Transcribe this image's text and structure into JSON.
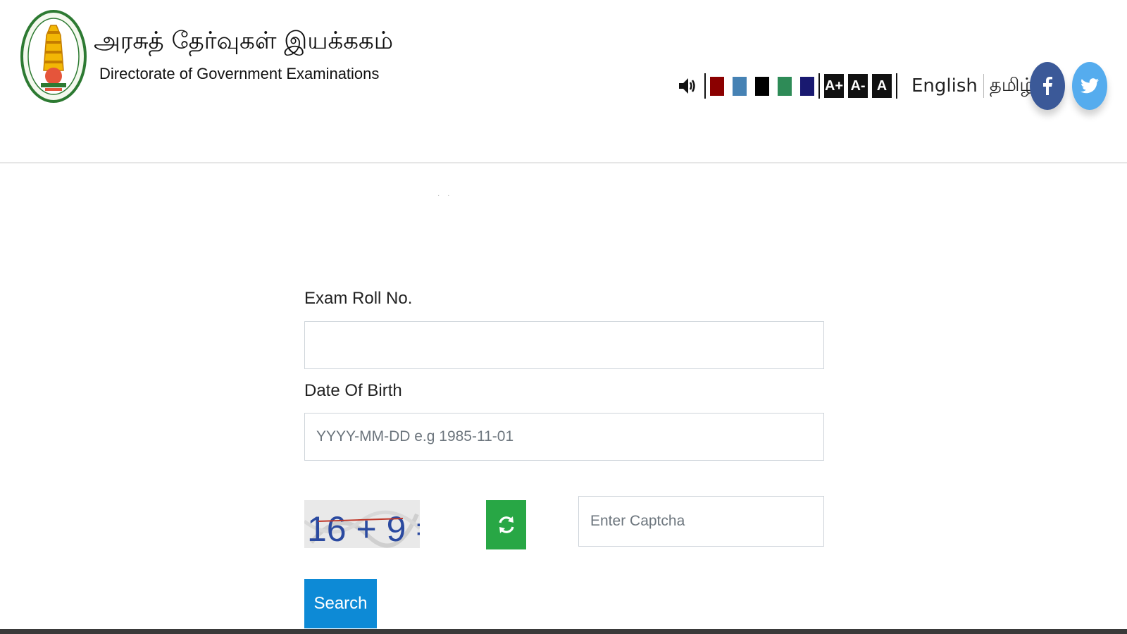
{
  "header": {
    "title_tamil": "அரசுத் தேர்வுகள் இயக்ககம்",
    "title_english": "Directorate of Government Examinations",
    "logo_icon": "tamil-nadu-emblem-icon",
    "accessibility": {
      "speaker_icon": "speaker-icon",
      "theme_colors": [
        "#8b0000",
        "#4682b4",
        "#000000",
        "#2e8b57",
        "#191970"
      ],
      "font_increase": "A+",
      "font_decrease": "A-",
      "font_reset": "A"
    },
    "languages": [
      "English",
      "தமிழ்"
    ],
    "social": [
      "facebook-icon",
      "twitter-icon"
    ]
  },
  "form": {
    "roll_label": "Exam Roll No.",
    "roll_value": "",
    "dob_label": "Date Of Birth",
    "dob_placeholder": "YYYY-MM-DD e.g 1985-11-01",
    "captcha_text": "16 + 9 =",
    "captcha_placeholder": "Enter Captcha",
    "search_label": "Search"
  },
  "colors": {
    "refresh": "#28a745",
    "search": "#0d8ad6"
  }
}
